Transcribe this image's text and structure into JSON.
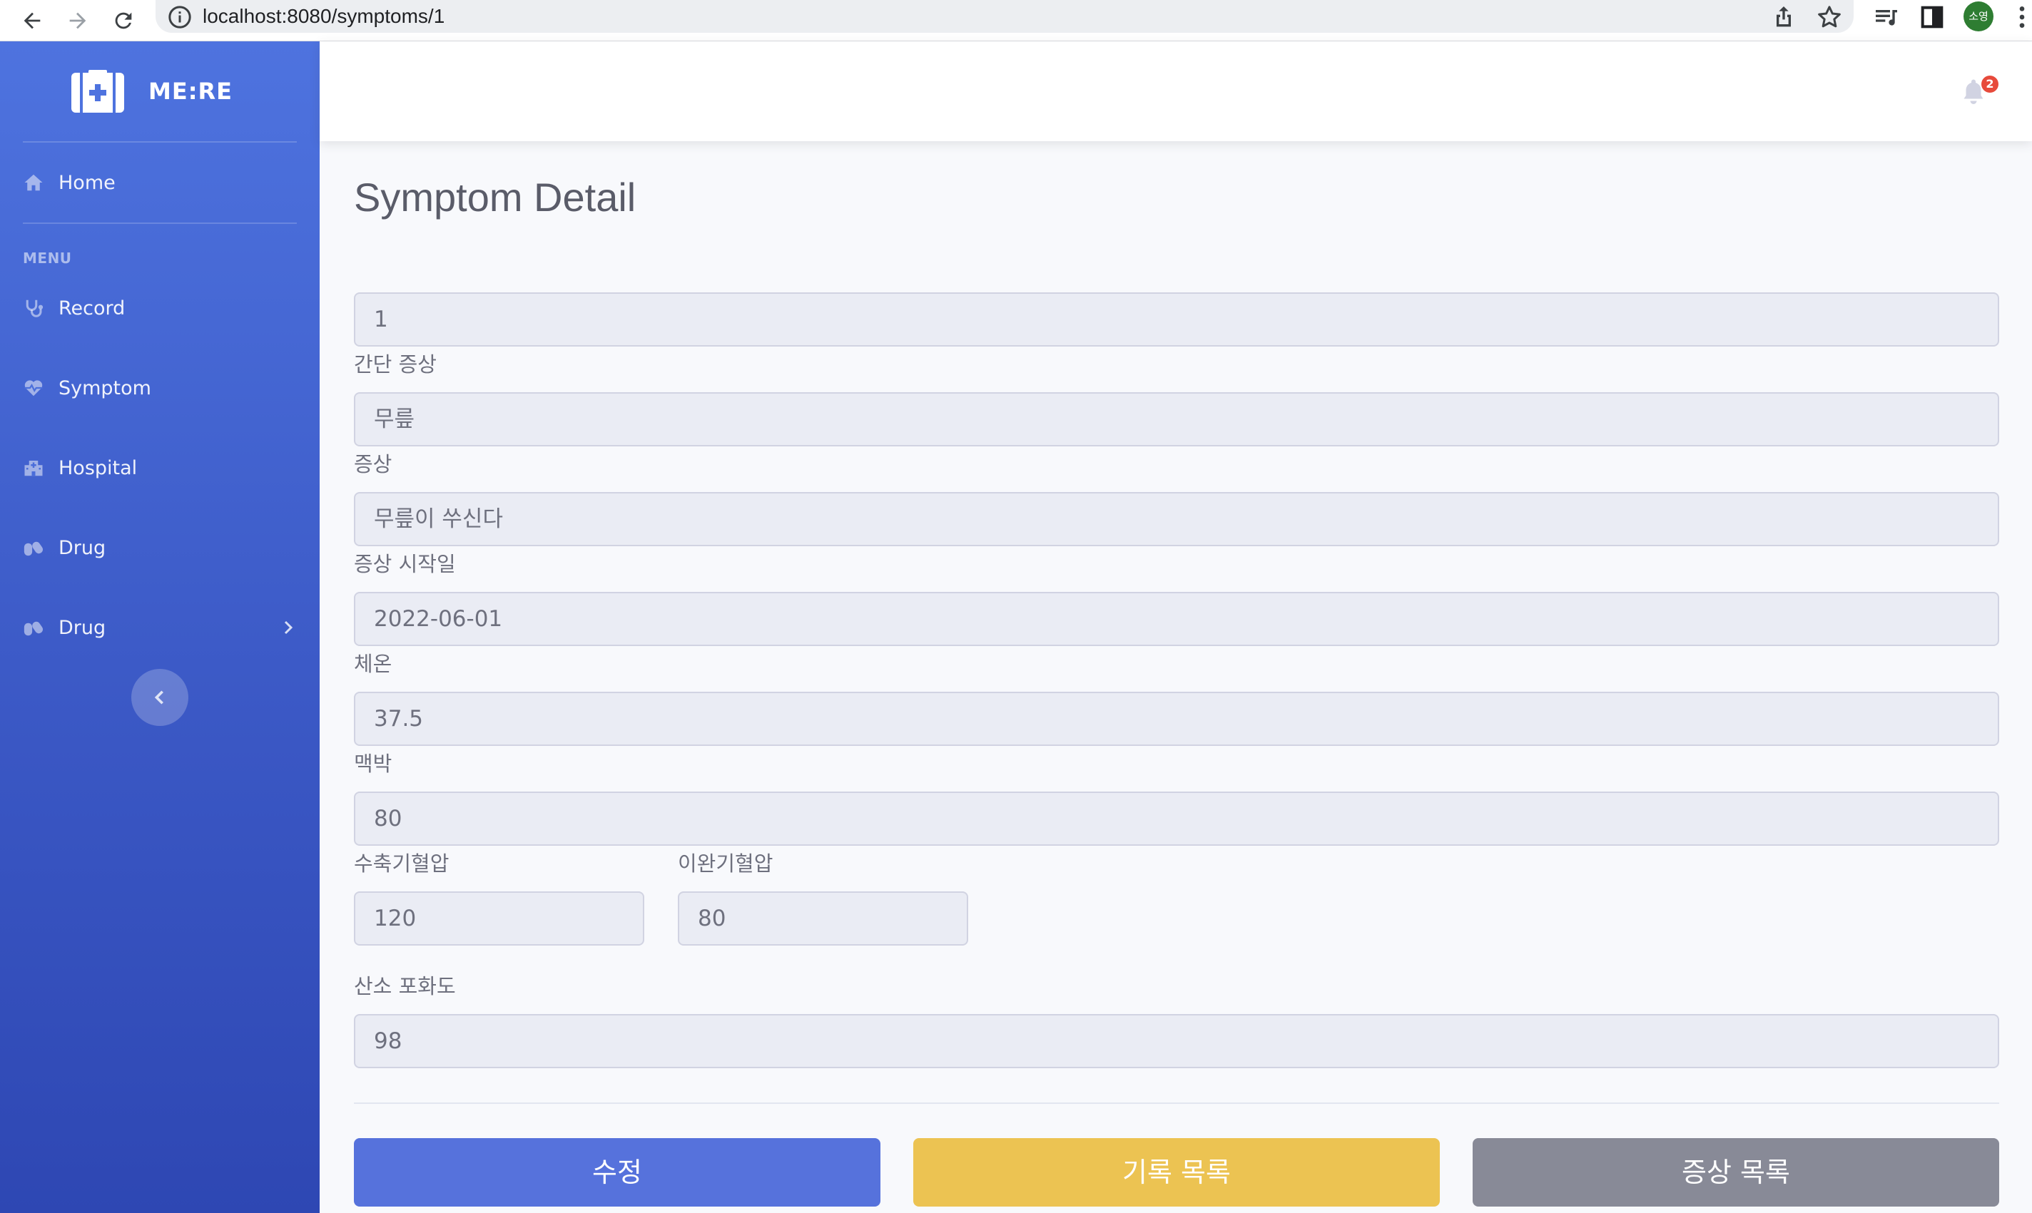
{
  "browser": {
    "url": "localhost:8080/symptoms/1",
    "profile_label": "소영"
  },
  "sidebar": {
    "brand": "ME:RE",
    "home_label": "Home",
    "menu_heading": "MENU",
    "items": [
      {
        "label": "Record",
        "icon": "stethoscope-icon"
      },
      {
        "label": "Symptom",
        "icon": "heartbeat-icon"
      },
      {
        "label": "Hospital",
        "icon": "hospital-icon"
      },
      {
        "label": "Drug",
        "icon": "capsules-icon"
      },
      {
        "label": "Drug",
        "icon": "capsules-icon",
        "expandable": true
      }
    ]
  },
  "topbar": {
    "notification_count": "2"
  },
  "page": {
    "title": "Symptom Detail"
  },
  "form": {
    "id_value": "1",
    "brief_label": "간단 증상",
    "brief_value": "무릎",
    "symptom_label": "증상",
    "symptom_value": "무릎이 쑤신다",
    "start_date_label": "증상 시작일",
    "start_date_value": "2022-06-01",
    "temperature_label": "체온",
    "temperature_value": "37.5",
    "pulse_label": "맥박",
    "pulse_value": "80",
    "systolic_label": "수축기혈압",
    "systolic_value": "120",
    "diastolic_label": "이완기혈압",
    "diastolic_value": "80",
    "oxygen_label": "산소 포화도",
    "oxygen_value": "98"
  },
  "buttons": {
    "edit": "수정",
    "record_list": "기록 목록",
    "symptom_list": "증상 목록"
  },
  "colors": {
    "primary": "#4e73df",
    "warning": "#f6c23e",
    "secondary": "#858796",
    "danger": "#e74a3b"
  }
}
